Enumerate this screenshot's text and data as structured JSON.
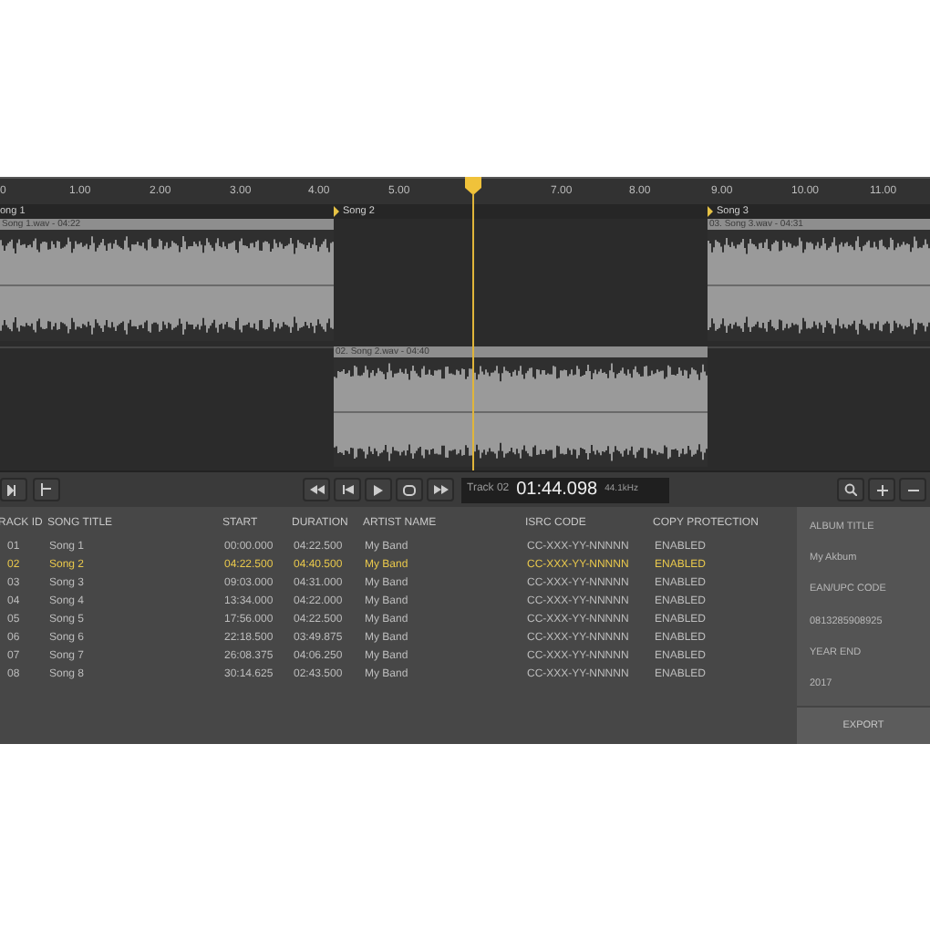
{
  "ruler": {
    "labels": [
      "0",
      "1.00",
      "2.00",
      "3.00",
      "4.00",
      "5.00",
      "7.00",
      "8.00",
      "9.00",
      "10.00",
      "11.00"
    ]
  },
  "markers": [
    {
      "label": "ong 1",
      "flag": false
    },
    {
      "label": "Song 2",
      "flag": true
    },
    {
      "label": "Song 3",
      "flag": true
    }
  ],
  "clips": [
    {
      "label": "Song 1.wav - 04:22"
    },
    {
      "label": "02. Song 2.wav - 04:40"
    },
    {
      "label": "03. Song 3.wav - 04:31"
    }
  ],
  "transport": {
    "track": "Track 02",
    "time": "01:44.098",
    "rate": "44.1kHz"
  },
  "table": {
    "columns": [
      "RACK ID",
      "SONG TITLE",
      "START",
      "DURATION",
      "ARTIST NAME",
      "ISRC CODE",
      "COPY PROTECTION"
    ],
    "rows": [
      {
        "cells": [
          "01",
          "Song 1",
          "00:00.000",
          "04:22.500",
          "My Band",
          "CC-XXX-YY-NNNNN",
          "ENABLED"
        ],
        "selected": false
      },
      {
        "cells": [
          "02",
          "Song 2",
          "04:22.500",
          "04:40.500",
          "My Band",
          "CC-XXX-YY-NNNNN",
          "ENABLED"
        ],
        "selected": true
      },
      {
        "cells": [
          "03",
          "Song 3",
          "09:03.000",
          "04:31.000",
          "My Band",
          "CC-XXX-YY-NNNNN",
          "ENABLED"
        ],
        "selected": false
      },
      {
        "cells": [
          "04",
          "Song 4",
          "13:34.000",
          "04:22.000",
          "My Band",
          "CC-XXX-YY-NNNNN",
          "ENABLED"
        ],
        "selected": false
      },
      {
        "cells": [
          "05",
          "Song 5",
          "17:56.000",
          "04:22.500",
          "My Band",
          "CC-XXX-YY-NNNNN",
          "ENABLED"
        ],
        "selected": false
      },
      {
        "cells": [
          "06",
          "Song 6",
          "22:18.500",
          "03:49.875",
          "My Band",
          "CC-XXX-YY-NNNNN",
          "ENABLED"
        ],
        "selected": false
      },
      {
        "cells": [
          "07",
          "Song 7",
          "26:08.375",
          "04:06.250",
          "My Band",
          "CC-XXX-YY-NNNNN",
          "ENABLED"
        ],
        "selected": false
      },
      {
        "cells": [
          "08",
          "Song 8",
          "30:14.625",
          "02:43.500",
          "My Band",
          "CC-XXX-YY-NNNNN",
          "ENABLED"
        ],
        "selected": false
      }
    ]
  },
  "album": {
    "fields": [
      {
        "label": "ALBUM TITLE",
        "value": "My Akbum"
      },
      {
        "label": "EAN/UPC CODE",
        "value": "0813285908925"
      },
      {
        "label": "YEAR END",
        "value": "2017"
      }
    ],
    "button": "EXPORT"
  }
}
